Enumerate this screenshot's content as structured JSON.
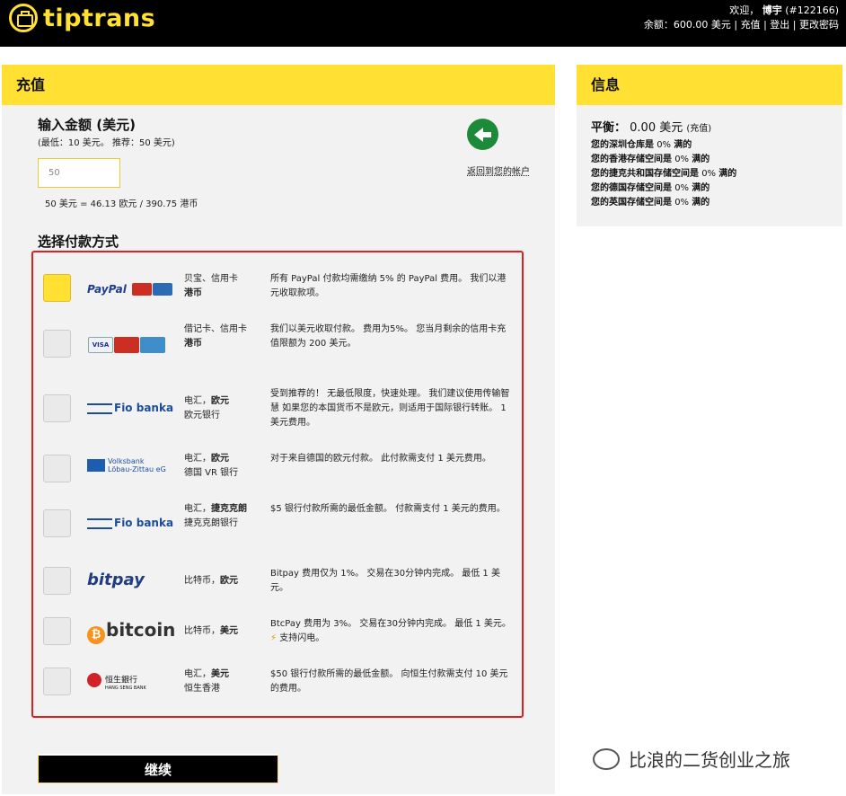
{
  "header": {
    "logo_text": "tiptrans",
    "welcome_prefix": "欢迎，",
    "user_name": "博宇",
    "user_id": "(#122166)",
    "balance_label": "余额：600.00 美元",
    "recharge_link": "充值",
    "logout_link": "登出",
    "change_password_link": "更改密码",
    "separator": "|"
  },
  "recharge_panel": {
    "title": "充值",
    "amount_title": "输入金额 (美元)",
    "amount_hint": "(最低：10 美元。 推荐：50 美元)",
    "amount_placeholder": "50",
    "conversion": "50 美元 = 46.13 欧元 / 390.75 港币",
    "back_link": "返回到您的帐户",
    "payment_title": "选择付款方式",
    "continue_label": "继续"
  },
  "payment_methods": [
    {
      "brand": "PayPal",
      "type_line1": "贝宝、信用卡",
      "type_line2": "港币",
      "description": "所有 PayPal 付款均需缴纳 5% 的 PayPal 费用。 我们以港元收取款项。",
      "selected": true
    },
    {
      "brand": "VISA",
      "type_line1": "借记卡、信用卡",
      "type_line2": "港币",
      "description": "我们以美元收取付款。 费用为5%。 您当月剩余的信用卡充值限额为 200 美元。",
      "selected": false
    },
    {
      "brand": "Fio banka",
      "type_line1": "电汇，",
      "type_bold": "欧元",
      "type_line2": "欧元银行",
      "description": "受到推荐的！ 无最低限度，快速处理。 我们建议使用传输智慧 如果您的本国货币不是欧元，则适用于国际银行转账。 1美元费用。",
      "selected": false
    },
    {
      "brand": "Volksbank",
      "brand_sub": "Löbau-Zittau eG",
      "type_line1": "电汇，",
      "type_bold": "欧元",
      "type_line2": "德国 VR 银行",
      "description": "对于来自德国的欧元付款。 此付款需支付 1 美元费用。",
      "selected": false
    },
    {
      "brand": "Fio banka",
      "type_line1": "电汇，",
      "type_bold": "捷克克朗",
      "type_line2": "捷克克朗银行",
      "description": "$5 银行付款所需的最低金额。 付款需支付 1 美元的费用。",
      "selected": false
    },
    {
      "brand": "bitpay",
      "type_line1": "比特币，",
      "type_bold": "欧元",
      "type_line2": "",
      "description": "Bitpay 费用仅为 1%。 交易在30分钟内完成。 最低 1 美元。",
      "selected": false
    },
    {
      "brand": "bitcoin",
      "brand_symbol": "₿",
      "type_line1": "比特币，",
      "type_bold": "美元",
      "type_line2": "",
      "description": "BtcPay 费用为 3%。 交易在30分钟内完成。 最低 1 美元。",
      "description_extra": "支持闪电。",
      "selected": false
    },
    {
      "brand": "恒生銀行",
      "brand_sub": "HANG SENG BANK",
      "type_line1": "电汇，",
      "type_bold": "美元",
      "type_line2": "恒生香港",
      "description": "$50 银行付款所需的最低金额。 向恒生付款需支付 10 美元的费用。",
      "selected": false
    }
  ],
  "info_panel": {
    "title": "信息",
    "balance_label": "平衡：",
    "balance_value": "0.00 美元",
    "balance_note": "(充值)",
    "lines": [
      {
        "prefix": "您的深圳仓库是",
        "pct": "0%",
        "suffix": "满的"
      },
      {
        "prefix": "您的香港存储空间是",
        "pct": "0%",
        "suffix": "满的"
      },
      {
        "prefix": "您的捷克共和国存储空间是",
        "pct": "0%",
        "suffix": "满的"
      },
      {
        "prefix": "您的德国存储空间是",
        "pct": "0%",
        "suffix": "满的"
      },
      {
        "prefix": "您的英国存储空间是",
        "pct": "0%",
        "suffix": "满的"
      }
    ]
  },
  "watermark": "比浪的二货创业之旅",
  "colors": {
    "brand_yellow": "#ffe033",
    "header_black": "#000000",
    "highlight_red": "#e02020",
    "back_green": "#1d8a3a"
  }
}
